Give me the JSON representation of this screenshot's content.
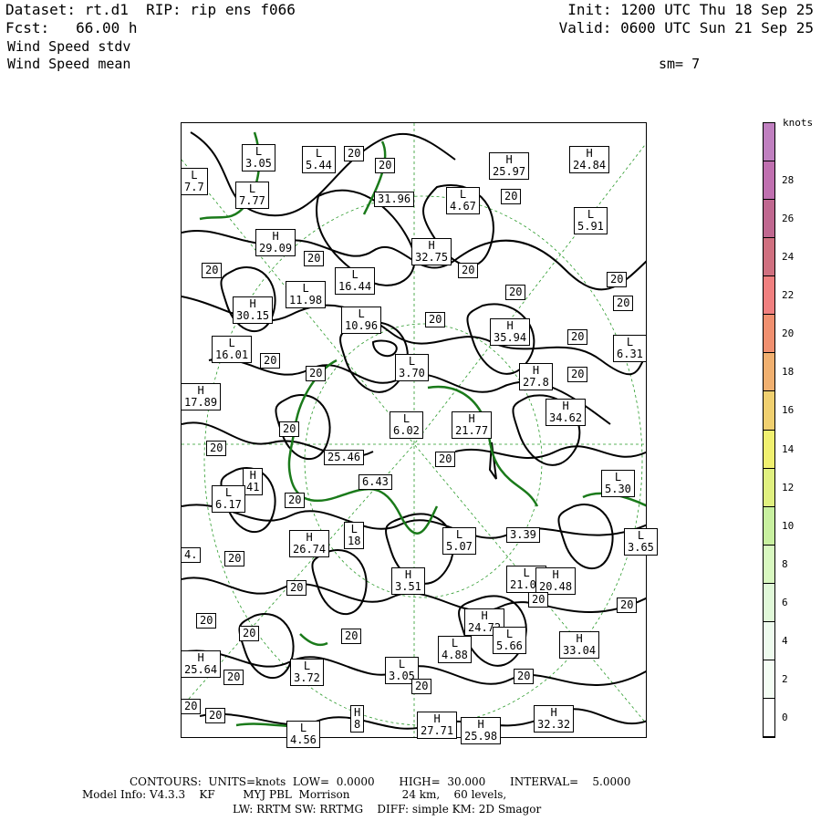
{
  "header": {
    "dataset": "Dataset: rt.d1  RIP: rip ens f066",
    "fcst": "Fcst:   66.00 h",
    "field1": "Wind Speed stdv",
    "field2": "Wind Speed mean",
    "init": "Init: 1200 UTC Thu 18 Sep 25",
    "valid": "Valid: 0600 UTC Sun 21 Sep 25",
    "sm": "sm= 7"
  },
  "colors": {
    "contour": "#000000",
    "coastline": "#1a7a1a",
    "gridline": "#2a9a2a"
  },
  "map_labels": [
    {
      "type": "L",
      "value": "3.05"
    },
    {
      "type": "L",
      "value": "5.44"
    },
    {
      "type": "",
      "value": "20"
    },
    {
      "type": "",
      "value": "20"
    },
    {
      "type": "H",
      "value": "25.97"
    },
    {
      "type": "H",
      "value": "24.84"
    },
    {
      "type": "L",
      "value": "7.7"
    },
    {
      "type": "L",
      "value": "7.77"
    },
    {
      "type": "",
      "value": "31.96"
    },
    {
      "type": "L",
      "value": "4.67"
    },
    {
      "type": "",
      "value": "20"
    },
    {
      "type": "L",
      "value": "5.91"
    },
    {
      "type": "H",
      "value": "29.09"
    },
    {
      "type": "H",
      "value": "32.75"
    },
    {
      "type": "",
      "value": "20"
    },
    {
      "type": "",
      "value": "20"
    },
    {
      "type": "",
      "value": "20"
    },
    {
      "type": "L",
      "value": "11.98"
    },
    {
      "type": "L",
      "value": "16.44"
    },
    {
      "type": "",
      "value": "20"
    },
    {
      "type": "",
      "value": "20"
    },
    {
      "type": "",
      "value": "20"
    },
    {
      "type": "H",
      "value": "30.15"
    },
    {
      "type": "L",
      "value": "10.96"
    },
    {
      "type": "",
      "value": "20"
    },
    {
      "type": "H",
      "value": "35.94"
    },
    {
      "type": "",
      "value": "20"
    },
    {
      "type": "L",
      "value": "6.31"
    },
    {
      "type": "L",
      "value": "16.01"
    },
    {
      "type": "",
      "value": "20"
    },
    {
      "type": "L",
      "value": "3.70"
    },
    {
      "type": "H",
      "value": "27.8"
    },
    {
      "type": "",
      "value": "20"
    },
    {
      "type": "",
      "value": "20"
    },
    {
      "type": "H",
      "value": "17.89"
    },
    {
      "type": "H",
      "value": "34.62"
    },
    {
      "type": "L",
      "value": "6.02"
    },
    {
      "type": "H",
      "value": "21.77"
    },
    {
      "type": "L",
      "value": "5.30"
    },
    {
      "type": "",
      "value": "20"
    },
    {
      "type": "",
      "value": "25.46"
    },
    {
      "type": "",
      "value": "20"
    },
    {
      "type": "H",
      "value": "41"
    },
    {
      "type": "",
      "value": "20"
    },
    {
      "type": "",
      "value": "6.43"
    },
    {
      "type": "L",
      "value": "6.17"
    },
    {
      "type": "",
      "value": "20"
    },
    {
      "type": "L",
      "value": "18"
    },
    {
      "type": "L",
      "value": "5.07"
    },
    {
      "type": "",
      "value": "3.39"
    },
    {
      "type": "L",
      "value": "3.65"
    },
    {
      "type": "H",
      "value": "26.74"
    },
    {
      "type": "",
      "value": "4."
    },
    {
      "type": "",
      "value": "20"
    },
    {
      "type": "H",
      "value": "3.51"
    },
    {
      "type": "L",
      "value": "21.09"
    },
    {
      "type": "H",
      "value": "20.48"
    },
    {
      "type": "",
      "value": "20"
    },
    {
      "type": "",
      "value": "20"
    },
    {
      "type": "",
      "value": "20"
    },
    {
      "type": "",
      "value": "20"
    },
    {
      "type": "H",
      "value": "24.72"
    },
    {
      "type": "",
      "value": "20"
    },
    {
      "type": "",
      "value": "20"
    },
    {
      "type": "L",
      "value": "4.88"
    },
    {
      "type": "L",
      "value": "5.66"
    },
    {
      "type": "H",
      "value": "33.04"
    },
    {
      "type": "H",
      "value": "25.64"
    },
    {
      "type": "L",
      "value": "3.72"
    },
    {
      "type": "L",
      "value": "3.05"
    },
    {
      "type": "",
      "value": "20"
    },
    {
      "type": "",
      "value": "20"
    },
    {
      "type": "",
      "value": "20"
    },
    {
      "type": "H",
      "value": "27.71"
    },
    {
      "type": "H",
      "value": "32.32"
    },
    {
      "type": "",
      "value": "20"
    },
    {
      "type": "",
      "value": "20"
    },
    {
      "type": "H",
      "value": "8"
    },
    {
      "type": "H",
      "value": "25.98"
    },
    {
      "type": "L",
      "value": "4.56"
    },
    {
      "type": "",
      "value": "20"
    },
    {
      "type": "L",
      "value": ""
    }
  ],
  "colorbar": {
    "units": "knots",
    "ticks": [
      "28",
      "26",
      "24",
      "22",
      "20",
      "18",
      "16",
      "14",
      "12",
      "10",
      "8",
      "6",
      "4",
      "2",
      "0"
    ],
    "colors": [
      "#c080c0",
      "#c070b0",
      "#c06890",
      "#d07080",
      "#f08080",
      "#f09070",
      "#f0b070",
      "#f0d070",
      "#f0f070",
      "#e0f080",
      "#c8f0a0",
      "#d8f8c0",
      "#e0f8d8",
      "#eefbee",
      "#f4fdf4",
      "#ffffff"
    ]
  },
  "footer": {
    "contours": "CONTOURS:  UNITS=knots  LOW=  0.0000       HIGH=  30.000       INTERVAL=    5.0000",
    "model": "Model Info: V4.3.3    KF        MYJ PBL  Morrison               24 km,    60 levels,",
    "physics": "LW: RRTM SW: RRTMG    DIFF: simple KM: 2D Smagor"
  }
}
